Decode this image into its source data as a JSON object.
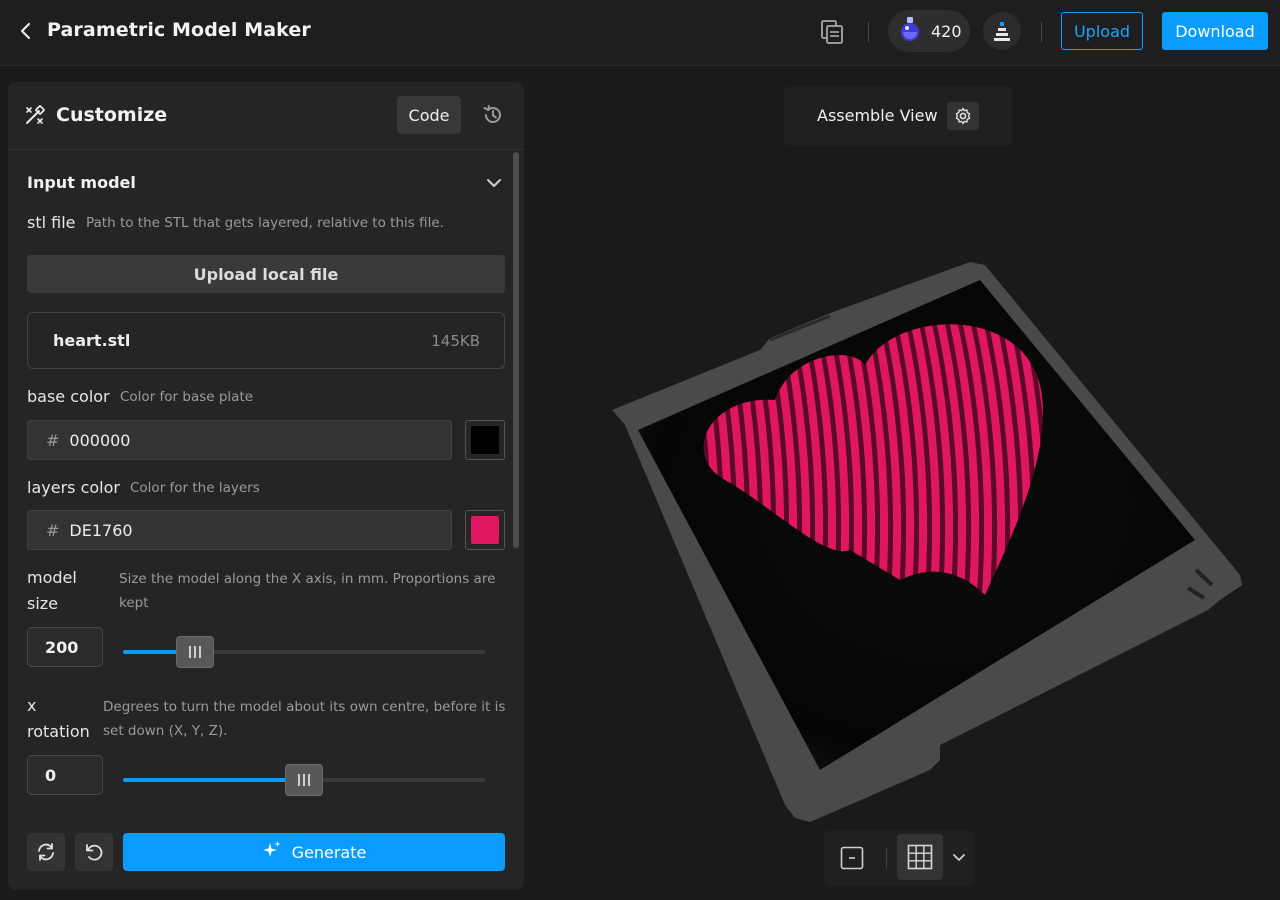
{
  "app": {
    "title": "Parametric Model Maker"
  },
  "topbar": {
    "credits": "420",
    "upload_label": "Upload",
    "download_label": "Download"
  },
  "panel": {
    "title": "Customize",
    "code_label": "Code",
    "section_title": "Input model",
    "stl": {
      "label": "stl file",
      "hint": "Path to the STL that gets layered, relative to this file.",
      "upload_label": "Upload local file",
      "file_name": "heart.stl",
      "file_size": "145KB"
    },
    "base_color": {
      "label": "base color",
      "hint": "Color for base plate",
      "hash": "#",
      "value": "000000",
      "swatch": "#000000"
    },
    "layers_color": {
      "label": "layers color",
      "hint": "Color for the layers",
      "hash": "#",
      "value": "DE1760",
      "swatch": "#DE1760"
    },
    "model_size": {
      "label_1": "model",
      "label_2": "size",
      "hint_1": "Size the model along the X axis, in mm. Proportions are",
      "hint_2": "kept",
      "value": "200",
      "slider_fraction": 0.2
    },
    "x_rotation": {
      "label_1": "x",
      "label_2": "rotation",
      "hint_1": "Degrees to turn the model about its own centre, before it is",
      "hint_2": "set down (X, Y, Z).",
      "value": "0",
      "slider_fraction": 0.5
    },
    "generate_label": "Generate"
  },
  "viewport": {
    "assemble_label": "Assemble View",
    "model_color": "#DE1760",
    "plate_color": "#4a4a4a"
  }
}
